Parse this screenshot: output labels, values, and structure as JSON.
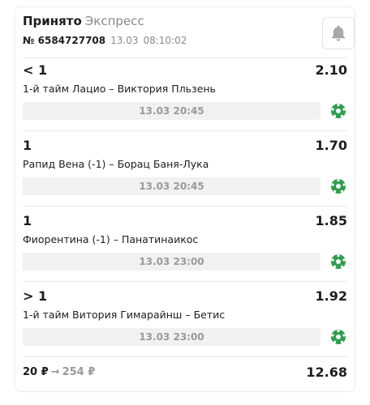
{
  "header": {
    "status": "Принято",
    "bet_type": "Экспресс",
    "bet_number": "№ 6584727708",
    "date": "13.03",
    "time": "08:10:02",
    "bell_icon": "bell-icon"
  },
  "events": [
    {
      "pick": "< 1",
      "odd": "2.10",
      "match": "1-й тайм Лацио – Виктория Пльзень",
      "start": "13.03 20:45",
      "sport_icon": "soccer-ball-icon"
    },
    {
      "pick": "1",
      "odd": "1.70",
      "match": "Рапид Вена (-1) – Борац Баня-Лука",
      "start": "13.03 20:45",
      "sport_icon": "soccer-ball-icon"
    },
    {
      "pick": "1",
      "odd": "1.85",
      "match": "Фиорентина (-1) – Панатинаикос",
      "start": "13.03 23:00",
      "sport_icon": "soccer-ball-icon"
    },
    {
      "pick": "> 1",
      "odd": "1.92",
      "match": "1-й тайм Витория Гимарайнш – Бетис",
      "start": "13.03 23:00",
      "sport_icon": "soccer-ball-icon"
    }
  ],
  "footer": {
    "stake": "20 ₽",
    "arrow": "→",
    "potential_win": "254 ₽",
    "total_odd": "12.68"
  },
  "colors": {
    "ball_green": "#2e9e4f",
    "muted_text": "#8a8a8a"
  }
}
